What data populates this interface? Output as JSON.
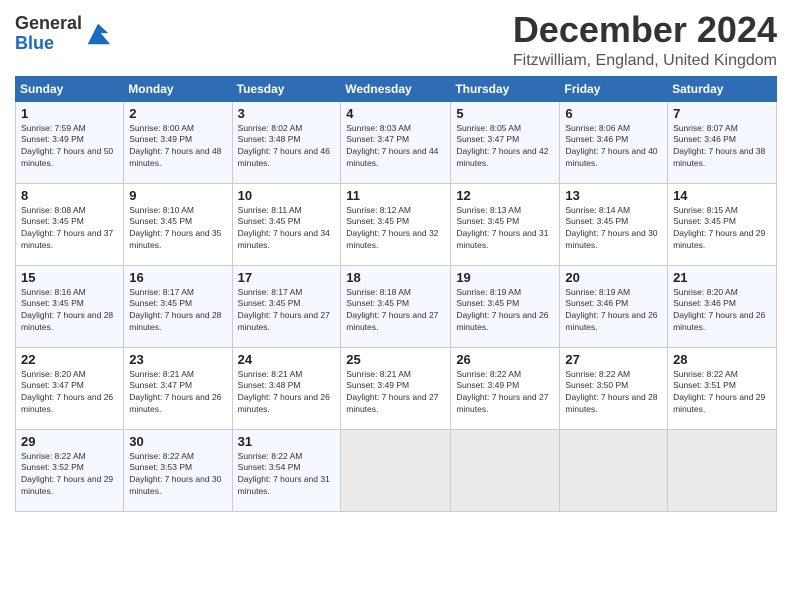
{
  "logo": {
    "line1": "General",
    "line2": "Blue"
  },
  "title": "December 2024",
  "subtitle": "Fitzwilliam, England, United Kingdom",
  "header_days": [
    "Sunday",
    "Monday",
    "Tuesday",
    "Wednesday",
    "Thursday",
    "Friday",
    "Saturday"
  ],
  "weeks": [
    [
      {
        "day": "1",
        "sunrise": "Sunrise: 7:59 AM",
        "sunset": "Sunset: 3:49 PM",
        "daylight": "Daylight: 7 hours and 50 minutes."
      },
      {
        "day": "2",
        "sunrise": "Sunrise: 8:00 AM",
        "sunset": "Sunset: 3:49 PM",
        "daylight": "Daylight: 7 hours and 48 minutes."
      },
      {
        "day": "3",
        "sunrise": "Sunrise: 8:02 AM",
        "sunset": "Sunset: 3:48 PM",
        "daylight": "Daylight: 7 hours and 46 minutes."
      },
      {
        "day": "4",
        "sunrise": "Sunrise: 8:03 AM",
        "sunset": "Sunset: 3:47 PM",
        "daylight": "Daylight: 7 hours and 44 minutes."
      },
      {
        "day": "5",
        "sunrise": "Sunrise: 8:05 AM",
        "sunset": "Sunset: 3:47 PM",
        "daylight": "Daylight: 7 hours and 42 minutes."
      },
      {
        "day": "6",
        "sunrise": "Sunrise: 8:06 AM",
        "sunset": "Sunset: 3:46 PM",
        "daylight": "Daylight: 7 hours and 40 minutes."
      },
      {
        "day": "7",
        "sunrise": "Sunrise: 8:07 AM",
        "sunset": "Sunset: 3:46 PM",
        "daylight": "Daylight: 7 hours and 38 minutes."
      }
    ],
    [
      {
        "day": "8",
        "sunrise": "Sunrise: 8:08 AM",
        "sunset": "Sunset: 3:45 PM",
        "daylight": "Daylight: 7 hours and 37 minutes."
      },
      {
        "day": "9",
        "sunrise": "Sunrise: 8:10 AM",
        "sunset": "Sunset: 3:45 PM",
        "daylight": "Daylight: 7 hours and 35 minutes."
      },
      {
        "day": "10",
        "sunrise": "Sunrise: 8:11 AM",
        "sunset": "Sunset: 3:45 PM",
        "daylight": "Daylight: 7 hours and 34 minutes."
      },
      {
        "day": "11",
        "sunrise": "Sunrise: 8:12 AM",
        "sunset": "Sunset: 3:45 PM",
        "daylight": "Daylight: 7 hours and 32 minutes."
      },
      {
        "day": "12",
        "sunrise": "Sunrise: 8:13 AM",
        "sunset": "Sunset: 3:45 PM",
        "daylight": "Daylight: 7 hours and 31 minutes."
      },
      {
        "day": "13",
        "sunrise": "Sunrise: 8:14 AM",
        "sunset": "Sunset: 3:45 PM",
        "daylight": "Daylight: 7 hours and 30 minutes."
      },
      {
        "day": "14",
        "sunrise": "Sunrise: 8:15 AM",
        "sunset": "Sunset: 3:45 PM",
        "daylight": "Daylight: 7 hours and 29 minutes."
      }
    ],
    [
      {
        "day": "15",
        "sunrise": "Sunrise: 8:16 AM",
        "sunset": "Sunset: 3:45 PM",
        "daylight": "Daylight: 7 hours and 28 minutes."
      },
      {
        "day": "16",
        "sunrise": "Sunrise: 8:17 AM",
        "sunset": "Sunset: 3:45 PM",
        "daylight": "Daylight: 7 hours and 28 minutes."
      },
      {
        "day": "17",
        "sunrise": "Sunrise: 8:17 AM",
        "sunset": "Sunset: 3:45 PM",
        "daylight": "Daylight: 7 hours and 27 minutes."
      },
      {
        "day": "18",
        "sunrise": "Sunrise: 8:18 AM",
        "sunset": "Sunset: 3:45 PM",
        "daylight": "Daylight: 7 hours and 27 minutes."
      },
      {
        "day": "19",
        "sunrise": "Sunrise: 8:19 AM",
        "sunset": "Sunset: 3:45 PM",
        "daylight": "Daylight: 7 hours and 26 minutes."
      },
      {
        "day": "20",
        "sunrise": "Sunrise: 8:19 AM",
        "sunset": "Sunset: 3:46 PM",
        "daylight": "Daylight: 7 hours and 26 minutes."
      },
      {
        "day": "21",
        "sunrise": "Sunrise: 8:20 AM",
        "sunset": "Sunset: 3:46 PM",
        "daylight": "Daylight: 7 hours and 26 minutes."
      }
    ],
    [
      {
        "day": "22",
        "sunrise": "Sunrise: 8:20 AM",
        "sunset": "Sunset: 3:47 PM",
        "daylight": "Daylight: 7 hours and 26 minutes."
      },
      {
        "day": "23",
        "sunrise": "Sunrise: 8:21 AM",
        "sunset": "Sunset: 3:47 PM",
        "daylight": "Daylight: 7 hours and 26 minutes."
      },
      {
        "day": "24",
        "sunrise": "Sunrise: 8:21 AM",
        "sunset": "Sunset: 3:48 PM",
        "daylight": "Daylight: 7 hours and 26 minutes."
      },
      {
        "day": "25",
        "sunrise": "Sunrise: 8:21 AM",
        "sunset": "Sunset: 3:49 PM",
        "daylight": "Daylight: 7 hours and 27 minutes."
      },
      {
        "day": "26",
        "sunrise": "Sunrise: 8:22 AM",
        "sunset": "Sunset: 3:49 PM",
        "daylight": "Daylight: 7 hours and 27 minutes."
      },
      {
        "day": "27",
        "sunrise": "Sunrise: 8:22 AM",
        "sunset": "Sunset: 3:50 PM",
        "daylight": "Daylight: 7 hours and 28 minutes."
      },
      {
        "day": "28",
        "sunrise": "Sunrise: 8:22 AM",
        "sunset": "Sunset: 3:51 PM",
        "daylight": "Daylight: 7 hours and 29 minutes."
      }
    ],
    [
      {
        "day": "29",
        "sunrise": "Sunrise: 8:22 AM",
        "sunset": "Sunset: 3:52 PM",
        "daylight": "Daylight: 7 hours and 29 minutes."
      },
      {
        "day": "30",
        "sunrise": "Sunrise: 8:22 AM",
        "sunset": "Sunset: 3:53 PM",
        "daylight": "Daylight: 7 hours and 30 minutes."
      },
      {
        "day": "31",
        "sunrise": "Sunrise: 8:22 AM",
        "sunset": "Sunset: 3:54 PM",
        "daylight": "Daylight: 7 hours and 31 minutes."
      },
      null,
      null,
      null,
      null
    ]
  ]
}
